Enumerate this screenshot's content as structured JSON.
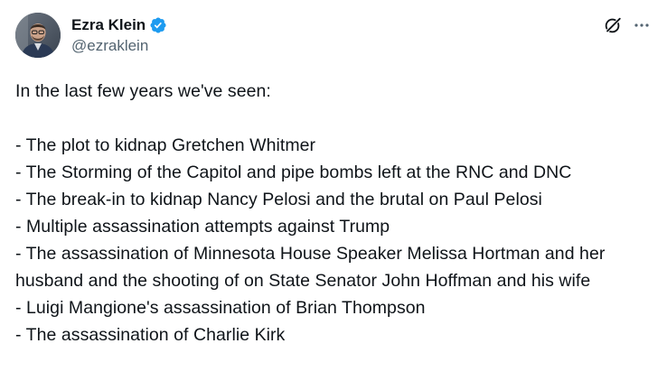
{
  "author": {
    "display_name": "Ezra Klein",
    "handle": "@ezraklein",
    "verified_badge_color": "#1d9bf0"
  },
  "icons": {
    "verified": "verified-badge-icon",
    "grok": "grok-icon",
    "more": "more-options-icon"
  },
  "tweet": {
    "intro": "In the last few years we've seen:",
    "items": [
      "- The plot to kidnap Gretchen Whitmer",
      "- The Storming of the Capitol and pipe bombs left at the RNC and DNC",
      "- The break-in to kidnap Nancy Pelosi and the brutal on Paul Pelosi",
      "- Multiple assassination attempts against Trump",
      "- The assassination of Minnesota House Speaker Melissa Hortman and her husband and the shooting of on State Senator John Hoffman and his wife",
      "- Luigi Mangione's assassination of Brian Thompson",
      "- The assassination of Charlie Kirk"
    ]
  },
  "colors": {
    "text_primary": "#0f1419",
    "text_secondary": "#536471",
    "accent": "#1d9bf0"
  }
}
